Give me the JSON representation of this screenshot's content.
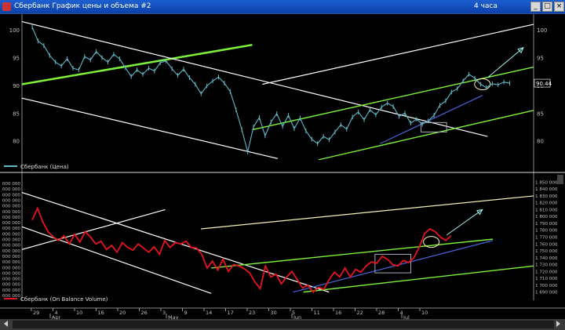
{
  "window": {
    "title": "Сбербанк График цены и объема #2",
    "timeframe": "4 часа",
    "buttons": {
      "minimize": "_",
      "maximize": "□",
      "close": "×"
    }
  },
  "colors": {
    "background": "#000000",
    "price_line": "#5fb8c8",
    "obv_line": "#e8141c",
    "green_channel": "#7cf03a",
    "white_line": "#ffffff",
    "yellow_line": "#f8f2b4",
    "blue_line": "#4b62d8",
    "axis_text": "#c0c0c0",
    "separator": "#ffffff"
  },
  "chart_data": [
    {
      "type": "line",
      "panel": "price",
      "legend": "Сбербанк (Цена)",
      "y_ticks": [
        "100",
        "95",
        "90",
        "85",
        "80"
      ],
      "ylim": [
        76,
        102
      ],
      "last_value_label": "90.44",
      "x_range": [
        0,
        100
      ],
      "series": [
        {
          "values": [
            100.5,
            98.0,
            97.2,
            95.4,
            94.2,
            93.5,
            94.8,
            93.1,
            92.8,
            95.2,
            94.6,
            96.1,
            95.0,
            94.2,
            95.6,
            94.8,
            93.2,
            91.6,
            92.8,
            92.0,
            93.1,
            92.6,
            94.1,
            94.4,
            93.0,
            91.8,
            92.9,
            91.4,
            90.2,
            88.5,
            89.9,
            90.8,
            91.5,
            90.4,
            88.9,
            85.6,
            82.0,
            78.0,
            82.5,
            84.2,
            80.9,
            83.4,
            84.9,
            82.6,
            84.6,
            82.2,
            84.1,
            81.8,
            80.3,
            79.5,
            80.8,
            80.2,
            81.6,
            82.9,
            82.1,
            84.3,
            85.2,
            83.8,
            85.6,
            84.7,
            86.1,
            86.8,
            86.2,
            84.4,
            85.0,
            83.2,
            83.9,
            83.0,
            83.6,
            84.6,
            86.4,
            87.2,
            88.8,
            89.4,
            90.8,
            92.0,
            91.3,
            90.2,
            89.6,
            90.3,
            90.1,
            90.6,
            90.4
          ]
        }
      ],
      "annotations": [
        {
          "type": "green_channel_upper",
          "x": [
            0,
            45
          ],
          "y": [
            90.2,
            97.3
          ]
        },
        {
          "type": "white_downtrend_upper",
          "x": [
            0,
            91
          ],
          "y": [
            101.5,
            80.8
          ]
        },
        {
          "type": "white_downtrend_lower",
          "x": [
            0,
            50
          ],
          "y": [
            87.7,
            76.8
          ]
        },
        {
          "type": "white_uptrend",
          "x": [
            47,
            100
          ],
          "y": [
            90.2,
            101.0
          ]
        },
        {
          "type": "green_channel_1",
          "x": [
            45,
            100
          ],
          "y": [
            82.0,
            93.3
          ]
        },
        {
          "type": "green_channel_2",
          "x": [
            58,
            100
          ],
          "y": [
            76.6,
            85.5
          ]
        },
        {
          "type": "blue_trend",
          "x": [
            70,
            90
          ],
          "y": [
            79.5,
            88.2
          ]
        },
        {
          "type": "box",
          "x": [
            78,
            83
          ],
          "y": [
            81.6,
            83.3
          ]
        },
        {
          "type": "circle",
          "x": 90,
          "y": 90.2
        },
        {
          "type": "arrow",
          "x": [
            91,
            98
          ],
          "y": [
            91.4,
            96.8
          ]
        }
      ]
    },
    {
      "type": "line",
      "panel": "volume",
      "legend": "Сбербанк (On Balance Volume)",
      "y_ticks_left": [
        "000 000",
        "000 000",
        "000 000",
        "000 000",
        "000 000",
        "000 000",
        "000 000",
        "000 000",
        "000 000",
        "000 000",
        "000 000",
        "000 000",
        "000 000",
        "000 000",
        "000 000",
        "000 000",
        "000 000",
        "000 000",
        "000 000",
        "000 000",
        "000 000"
      ],
      "y_ticks_right": [
        "1 850 000",
        "1 840 000",
        "1 830 000",
        "1 820 000",
        "1 810 000",
        "1 800 000",
        "1 790 000",
        "1 780 000",
        "1 770 000",
        "1 760 000",
        "1 750 000",
        "1 740 000",
        "1 730 000",
        "1 720 000",
        "1 710 000",
        "1 700 000",
        "1 690 000"
      ],
      "last_value_label": "",
      "ylim": [
        1685000,
        1855000
      ],
      "x_range": [
        0,
        100
      ],
      "series": [
        {
          "values": [
            1795000,
            1812000,
            1792000,
            1778000,
            1770000,
            1765000,
            1772000,
            1760000,
            1774000,
            1763000,
            1778000,
            1770000,
            1760000,
            1764000,
            1752000,
            1758000,
            1748000,
            1762000,
            1755000,
            1751000,
            1760000,
            1754000,
            1748000,
            1756000,
            1745000,
            1765000,
            1755000,
            1762000,
            1760000,
            1764000,
            1755000,
            1754000,
            1745000,
            1725000,
            1735000,
            1722000,
            1738000,
            1720000,
            1730000,
            1728000,
            1724000,
            1718000,
            1705000,
            1695000,
            1728000,
            1712000,
            1716000,
            1702000,
            1712000,
            1720000,
            1708000,
            1696000,
            1700000,
            1690000,
            1697000,
            1694000,
            1708000,
            1719000,
            1712000,
            1725000,
            1712000,
            1723000,
            1719000,
            1728000,
            1734000,
            1732000,
            1742000,
            1738000,
            1730000,
            1728000,
            1736000,
            1733000,
            1740000,
            1755000,
            1775000,
            1782000,
            1778000,
            1770000,
            1765000,
            1772000
          ]
        }
      ],
      "annotations": [
        {
          "type": "white_channel_upper",
          "x": [
            0,
            60
          ],
          "y": [
            1835000,
            1690000
          ]
        },
        {
          "type": "white_channel_lower",
          "x": [
            0,
            37
          ],
          "y": [
            1785000,
            1688000
          ]
        },
        {
          "type": "white_cross",
          "x": [
            0,
            28
          ],
          "y": [
            1752000,
            1810000
          ]
        },
        {
          "type": "yellow_trend",
          "x": [
            35,
            100
          ],
          "y": [
            1782000,
            1830000
          ]
        },
        {
          "type": "green_channel_upper",
          "x": [
            37,
            92
          ],
          "y": [
            1725000,
            1767000
          ]
        },
        {
          "type": "green_channel_lower",
          "x": [
            55,
            100
          ],
          "y": [
            1690000,
            1728000
          ]
        },
        {
          "type": "blue_trend",
          "x": [
            53,
            92
          ],
          "y": [
            1690000,
            1765000
          ]
        },
        {
          "type": "box",
          "x": [
            69,
            76
          ],
          "y": [
            1718000,
            1745000
          ]
        },
        {
          "type": "circle",
          "x": 80,
          "y": 1763000
        },
        {
          "type": "arrow",
          "x": [
            83,
            90
          ],
          "y": [
            1773000,
            1810000
          ]
        }
      ]
    }
  ],
  "x_axis": {
    "day_labels": [
      "29",
      "4",
      "10",
      "16",
      "20",
      "26",
      "3",
      "9",
      "14",
      "17",
      "23",
      "30",
      "5",
      "11",
      "16",
      "22",
      "28",
      "4",
      "10"
    ],
    "month_labels": [
      "Apr",
      "May",
      "Jun",
      "Jul"
    ]
  }
}
